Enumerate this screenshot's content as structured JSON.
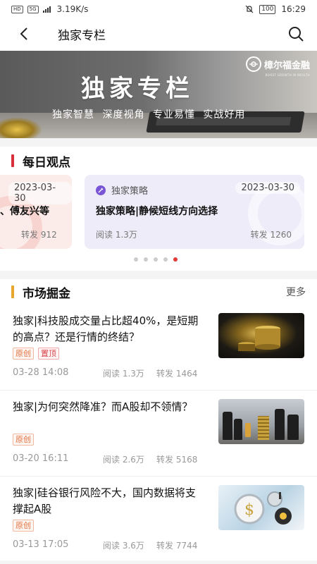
{
  "status_bar": {
    "network_badge": "HD",
    "signal_badge": "5G",
    "speed": "3.19K/s",
    "battery": "100",
    "time": "16:29"
  },
  "nav": {
    "title": "独家专栏",
    "back_icon": "chevron-left-icon",
    "search_icon": "search-icon"
  },
  "banner": {
    "title": "独家专栏",
    "subtitle": "独家智慧  深度视角  专业易懂  实战好用",
    "logo_text": "樟尔福金融",
    "logo_subtext": "BOOST GROWTH IN WEALTH"
  },
  "daily_views": {
    "section_title": "每日观点",
    "cards": [
      {
        "date": "2023-03-30",
        "title": "、傅友兴等",
        "forwards_label": "转发 912"
      },
      {
        "tag": "独家策略",
        "date": "2023-03-30",
        "title": "独家策略|静候短线方向选择",
        "reads_label": "阅读 1.3万",
        "forwards_label": "转发 1260"
      }
    ],
    "pagination": {
      "total": 5,
      "active_index": 4
    }
  },
  "market": {
    "section_title": "市场掘金",
    "more_label": "更多",
    "articles": [
      {
        "title": "独家|科技股成交量占比超40%，是短期的高点？还是行情的终结？",
        "tags": [
          "原创",
          "置顶"
        ],
        "time": "03-28 14:08",
        "reads": "阅读 1.3万",
        "forwards": "转发 1464"
      },
      {
        "title": "独家|为何突然降准？而A股却不领情？",
        "tags": [
          "原创"
        ],
        "time": "03-20 16:11",
        "reads": "阅读 2.6万",
        "forwards": "转发 5168"
      },
      {
        "title": "独家|硅谷银行风险不大，国内数据将支撑起A股",
        "tags": [
          "原创"
        ],
        "time": "03-13 17:05",
        "reads": "阅读 3.6万",
        "forwards": "转发 7744"
      }
    ]
  },
  "colors": {
    "accent_red": "#d8303a",
    "accent_gold": "#e6a72c",
    "card_purple": "#eeecf8",
    "card_pink": "#fbecea",
    "active_dot": "#e53935"
  }
}
